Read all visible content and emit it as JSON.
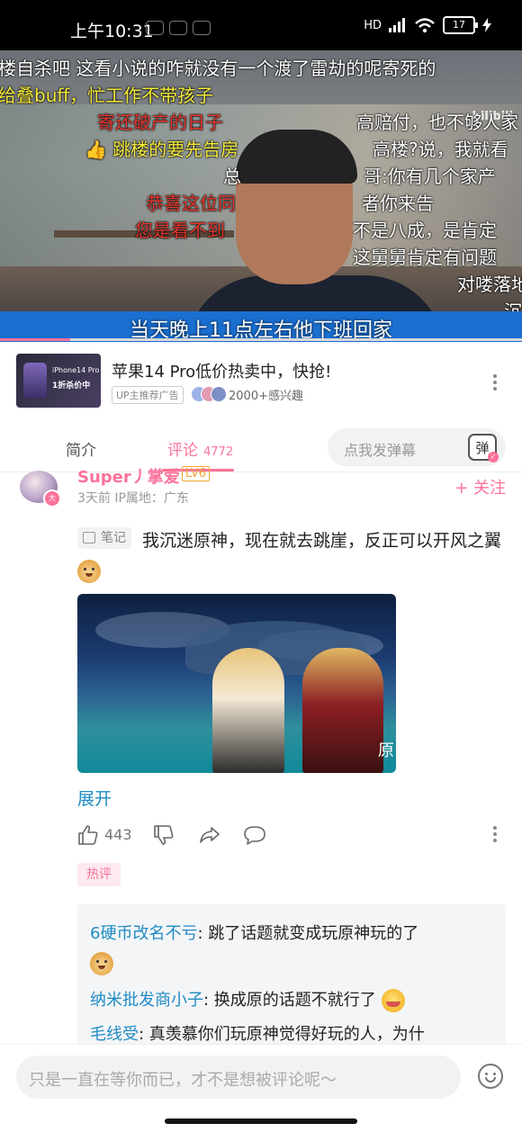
{
  "status_bar": {
    "time": "上午10:31",
    "network": "HD",
    "battery": "17"
  },
  "video": {
    "logo": "bilibili",
    "subtitle": "当天晚上11点左右他下班回家",
    "progress_fraction": 0.135,
    "danmaku": [
      {
        "text": "楼自杀吧   这看小说的咋就没有一个渡了雷劫的呢寄死的",
        "color": "white"
      },
      {
        "text": "给叠buff，忙工作不带孩子",
        "color": "yellow"
      },
      {
        "text": "寄还破产的日子",
        "color": "red"
      },
      {
        "text": "高赔付，也不够人家",
        "color": "white"
      },
      {
        "text": "👍 跳楼的要先告房",
        "color": "yellow"
      },
      {
        "text": "高楼?说，我就看",
        "color": "white"
      },
      {
        "text": "总",
        "color": "white"
      },
      {
        "text": "哥:你有几个家产",
        "color": "white"
      },
      {
        "text": "恭喜这位同",
        "color": "red"
      },
      {
        "text": "者你来告",
        "color": "white"
      },
      {
        "text": "您是看不到",
        "color": "red"
      },
      {
        "text": "不是八成，是肯定",
        "color": "white"
      },
      {
        "text": "这舅舅肯定有问题",
        "color": "white"
      },
      {
        "text": "对喽落地",
        "color": "white"
      },
      {
        "text": "沉",
        "color": "white"
      }
    ]
  },
  "ad": {
    "thumb_line1": "iPhone14 Pro",
    "thumb_line2": "1折杀价中",
    "title": "苹果14 Pro低价热卖中，快抢!",
    "tag": "UP主推荐广告",
    "interest": "2000+感兴趣"
  },
  "tabs": {
    "intro": "简介",
    "comments": "评论",
    "comments_count": "4772",
    "danmu_placeholder": "点我发弹幕",
    "danmu_toggle": "弹"
  },
  "comment": {
    "avatar_badge": "大",
    "username": "Super丿掌爱",
    "level": "LV6",
    "meta": "3天前  IP属地：广东",
    "follow": "+ 关注",
    "note_tag": "笔记",
    "text": "我沉迷原神，现在就去跳崖，反正可以开风之翼",
    "image_label": "原",
    "expand": "展开",
    "likes": "443",
    "hot_tag": "热评",
    "replies": [
      {
        "user": "6硬币改名不亏",
        "text": ": 跳了话题就变成玩原神玩的了"
      },
      {
        "user": "纳米批发商小子",
        "text": ": 换成原的话题不就行了"
      },
      {
        "user": "毛线受",
        "text": ": 真羡慕你们玩原神觉得好玩的人，为什"
      }
    ]
  },
  "bottom_input": {
    "placeholder": "只是一直在等你而已，才不是想被评论呢～"
  },
  "colors": {
    "accent_pink": "#fb7299",
    "link_blue": "#1f8bc4",
    "subtitle_blue": "#1a6fd1"
  }
}
